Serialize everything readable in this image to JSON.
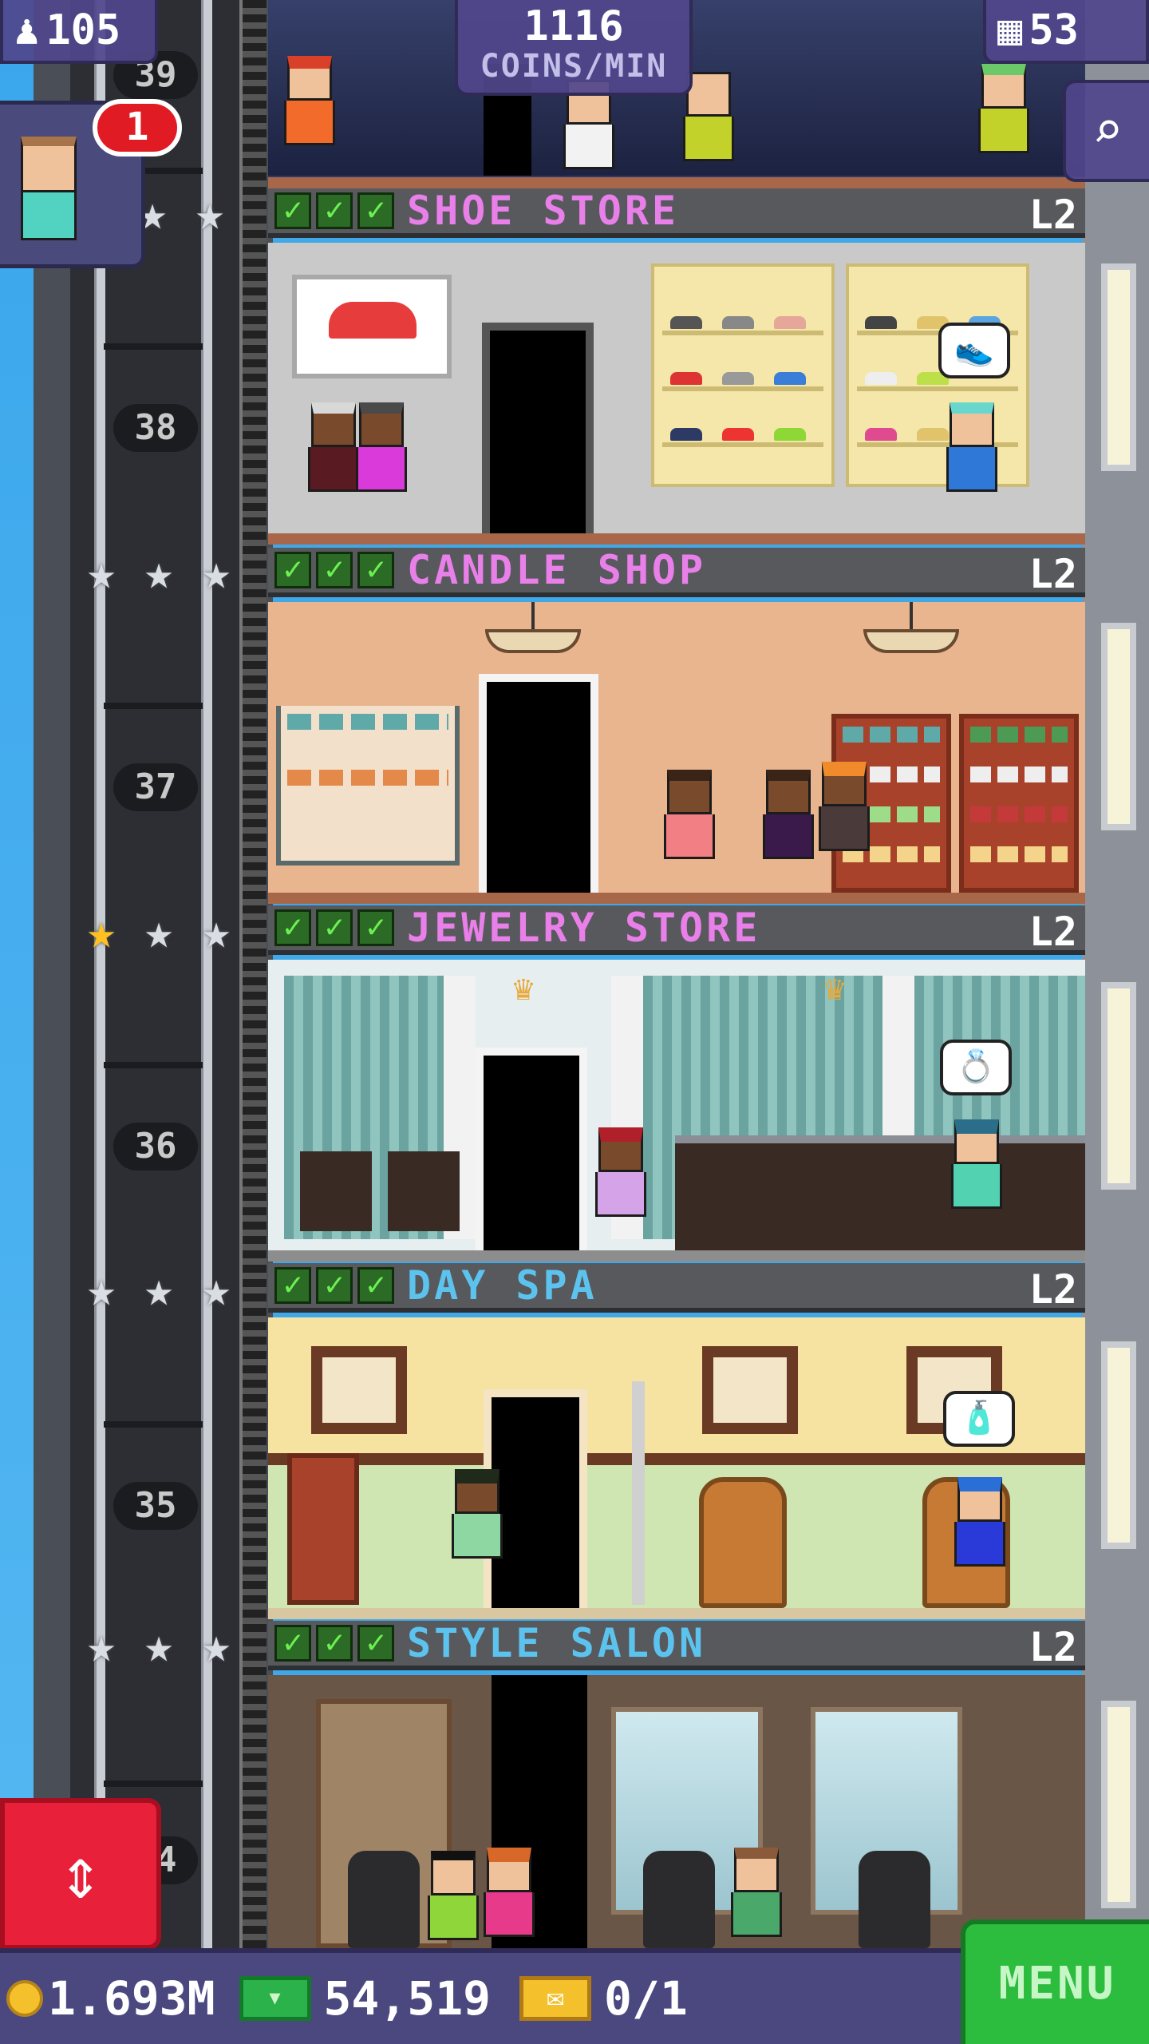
{
  "topbar": {
    "population": "105",
    "coins_per_min_value": "1116",
    "coins_per_min_label": "COINS/MIN",
    "floors_count": "53",
    "icons": {
      "population": "person-icon",
      "floors": "building-icon",
      "search": "magnifier-icon"
    }
  },
  "mission": {
    "badge_count": "1"
  },
  "floors": [
    {
      "shaft_number": "39",
      "name": "SHOE STORE",
      "level": "L2",
      "color": "pink",
      "checks": 3
    },
    {
      "shaft_number": "38",
      "name": "CANDLE SHOP",
      "level": "L2",
      "color": "pink",
      "checks": 3
    },
    {
      "shaft_number": "37",
      "name": "JEWELRY STORE",
      "level": "L2",
      "color": "pink",
      "checks": 3
    },
    {
      "shaft_number": "36",
      "name": "DAY SPA",
      "level": "L2",
      "color": "blue",
      "checks": 3
    },
    {
      "shaft_number": "35",
      "name": "STYLE SALON",
      "level": "L2",
      "color": "blue",
      "checks": 3
    },
    {
      "shaft_number": "34"
    }
  ],
  "star_rows": [
    {
      "gold": 0,
      "total": 3
    },
    {
      "gold": 0,
      "total": 3
    },
    {
      "gold": 1,
      "total": 3
    },
    {
      "gold": 0,
      "total": 3
    },
    {
      "gold": 0,
      "total": 3
    }
  ],
  "bottombar": {
    "coins": "1.693M",
    "bux": "54,519",
    "tickets": "0/1",
    "menu_label": "MENU"
  },
  "colors": {
    "pink_text": "#e97fe9",
    "blue_text": "#5cc3ef",
    "check_green": "#6cf052",
    "menu_green": "#2cbc3e",
    "elevator_red": "#e8203a",
    "bar_purple": "#4b4880"
  }
}
